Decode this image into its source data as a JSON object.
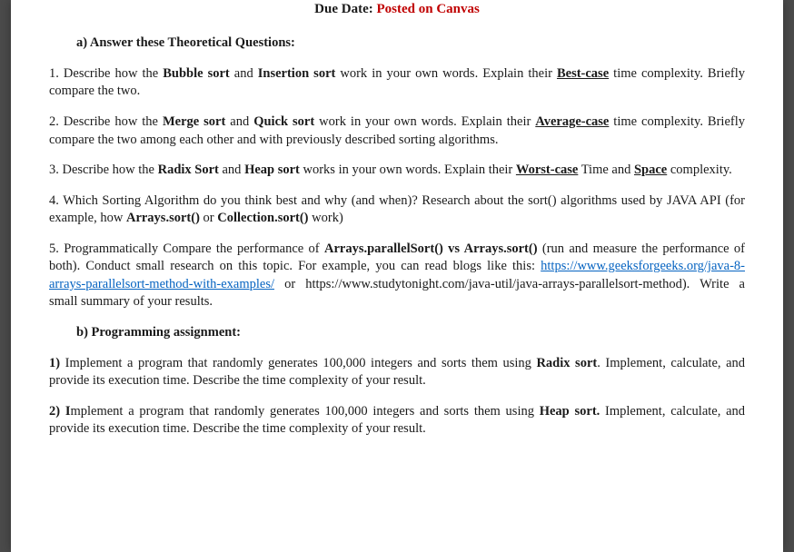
{
  "dueDate": {
    "label": "Due Date: ",
    "value": "Posted on Canvas"
  },
  "sectionA": {
    "heading": "a)  Answer these Theoretical Questions:",
    "q1": {
      "prefix": "1. Describe how the ",
      "bold1": "Bubble sort",
      "mid1": " and ",
      "bold2": "Insertion sort",
      "mid2": " work in your own words. Explain their ",
      "boldU": "Best-case",
      "suffix": " time complexity. Briefly compare the two."
    },
    "q2": {
      "prefix": "2. Describe how the ",
      "bold1": "Merge sort",
      "mid1": " and ",
      "bold2": "Quick sort",
      "mid2": " work in your own words. Explain their ",
      "boldU": "Average-case",
      "suffix": " time complexity. Briefly compare the two among each other and with previously described sorting algorithms."
    },
    "q3": {
      "prefix": "3.  Describe how the ",
      "bold1": "Radix Sort",
      "mid1": " and ",
      "bold2": "Heap sort",
      "mid2": " works in your own words. Explain their ",
      "boldU1": "Worst-case",
      "mid3": " Time and ",
      "boldU2": "Space",
      "suffix": " complexity."
    },
    "q4": {
      "prefix": "4. Which Sorting Algorithm do you think best and why (and when)? Research about the sort() algorithms used by JAVA API (for example, how ",
      "bold1": "Arrays.sort()",
      "mid1": " or ",
      "bold2": "Collection.sort()",
      "suffix": " work)"
    },
    "q5": {
      "prefix": "5. Programmatically Compare the performance of ",
      "bold1": "Arrays.parallelSort() vs Arrays.sort()",
      "mid1": " (run and measure the performance of both). Conduct small research on this topic. For example, you can read blogs like this: ",
      "link1": "https://www.geeksforgeeks.org/java-8-arrays-parallelsort-method-with-examples/",
      "mid2": " or https://www.studytonight.com/java-util/java-arrays-parallelsort-method). Write a small summary of your results."
    }
  },
  "sectionB": {
    "heading": "b)  Programming assignment:",
    "p1": {
      "num": "1) ",
      "prefix": "Implement a program that randomly generates 100,000 integers and sorts them using ",
      "bold1": "Radix sort",
      "suffix": ". Implement, calculate, and provide its execution time. Describe the time complexity of your result."
    },
    "p2": {
      "num": "2) I",
      "prefix": "mplement a program that randomly generates 100,000 integers and sorts them using ",
      "bold1": "Heap sort.",
      "suffix": " Implement, calculate, and provide its execution time. Describe the time complexity of your result."
    }
  }
}
